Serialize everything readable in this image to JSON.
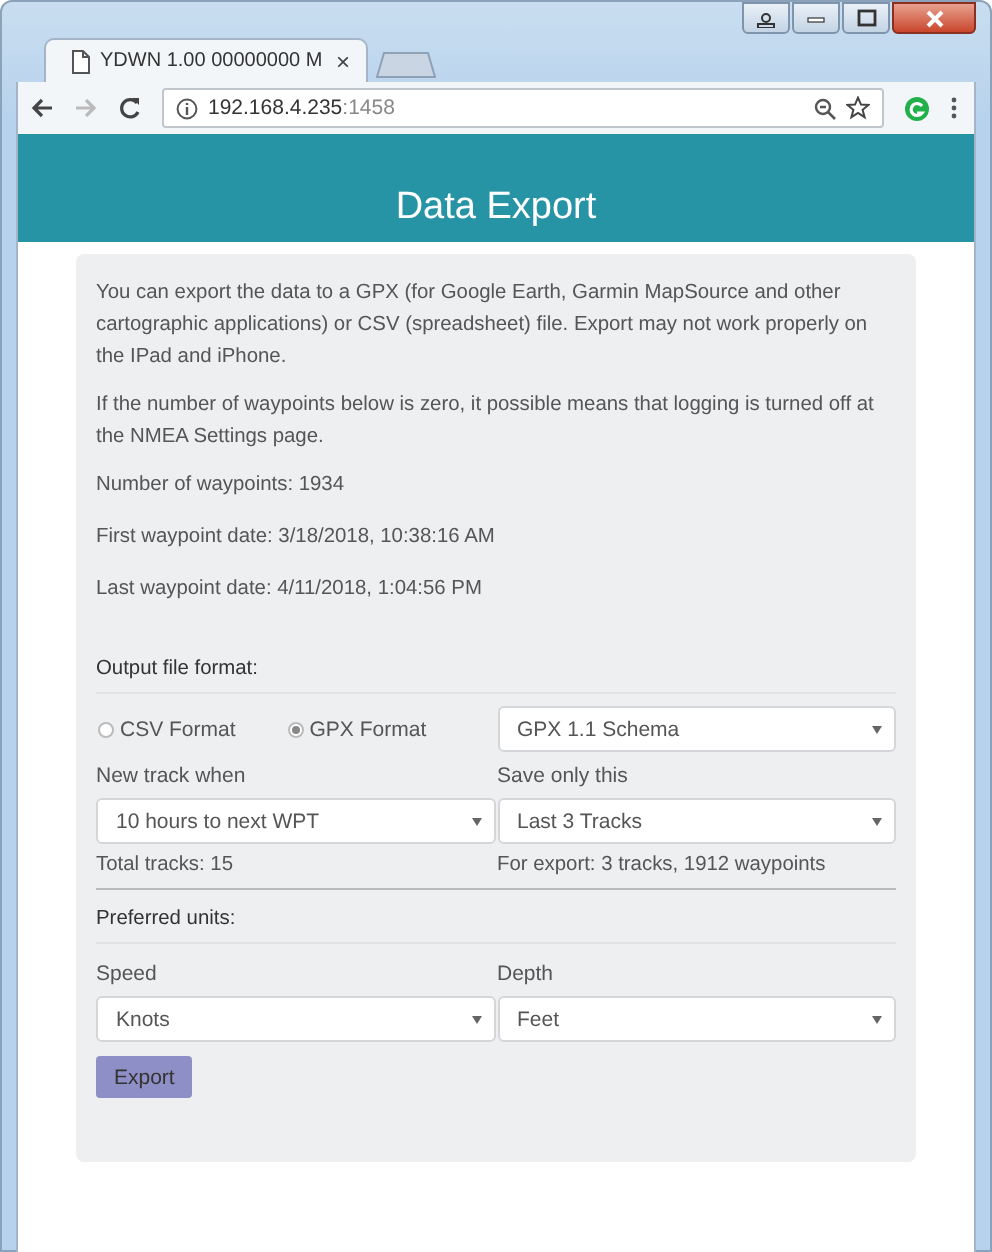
{
  "browser": {
    "tab_title": "YDWN 1.00 00000000 M",
    "tab_close": "×",
    "url_host": "192.168.4.235",
    "url_port": ":1458"
  },
  "header": {
    "title": "Data Export"
  },
  "intro": [
    "You can export the data to a GPX (for Google Earth, Garmin MapSource and other cartographic applications) or CSV (spreadsheet) file. Export may not work properly on the IPad and iPhone.",
    "If the number of waypoints below is zero, it possible means that logging is turned off at the NMEA Settings page."
  ],
  "stats": [
    "Number of waypoints: 1934",
    "First waypoint date: 3/18/2018, 10:38:16 AM",
    "Last waypoint date: 4/11/2018, 1:04:56 PM"
  ],
  "output_format": {
    "label": "Output file format:",
    "options": [
      {
        "label": "CSV Format",
        "selected": false
      },
      {
        "label": "GPX Format",
        "selected": true
      }
    ],
    "schema": "GPX 1.1 Schema"
  },
  "new_track": {
    "label": "New track when",
    "value": "10 hours to next WPT",
    "note": "Total tracks: 15"
  },
  "save_only": {
    "label": "Save only this",
    "value": "Last 3 Tracks",
    "note": "For export: 3 tracks, 1912 waypoints"
  },
  "units": {
    "label": "Preferred units:",
    "fields": [
      {
        "label": "Speed",
        "value": "Knots"
      },
      {
        "label": "Depth",
        "value": "Feet"
      }
    ]
  },
  "export_button": "Export"
}
